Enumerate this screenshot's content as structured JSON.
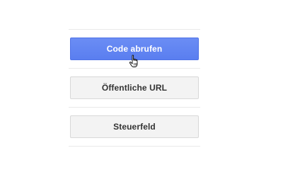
{
  "buttons": {
    "get_code": "Code abrufen",
    "public_url": "Öffentliche URL",
    "control_panel": "Steuerfeld"
  },
  "cursor": {
    "icon": "hand-pointer-icon"
  },
  "colors": {
    "primary": "#5a7ef0",
    "secondary_bg": "#f3f3f3",
    "divider": "#e9e9e9"
  }
}
